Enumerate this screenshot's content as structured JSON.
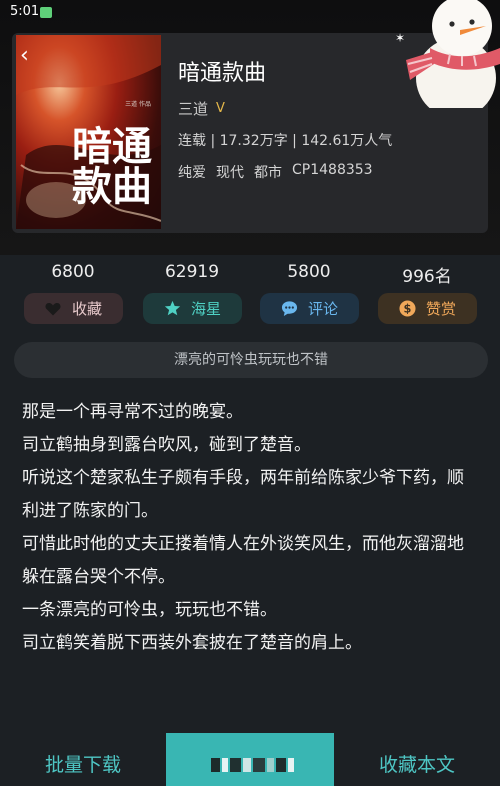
{
  "status_bar": {
    "time": "5:01"
  },
  "book": {
    "title": "暗通款曲",
    "author": "三道",
    "author_badge": "V",
    "stats": "连载 | 17.32万字 | 142.61万人气",
    "tags": [
      "纯爱",
      "现代",
      "都市",
      "CP1488353"
    ],
    "cover": {
      "title": "暗通款曲",
      "author_credit": "三道 作品"
    }
  },
  "counts": {
    "collect": "6800",
    "star": "62919",
    "comment": "5800",
    "reward": "996名"
  },
  "actions": {
    "collect": "收藏",
    "star": "海星",
    "comment": "评论",
    "reward": "赞赏"
  },
  "intro": "漂亮的可怜虫玩玩也不错",
  "excerpt": [
    "那是一个再寻常不过的晚宴。",
    "司立鹤抽身到露台吹风，碰到了楚音。",
    "听说这个楚家私生子颇有手段，两年前给陈家少爷下药，顺利进了陈家的门。",
    "可惜此时他的丈夫正搂着情人在外谈笑风生，而他灰溜溜地躲在露台哭个不停。",
    "一条漂亮的可怜虫，玩玩也不错。",
    "司立鹤笑着脱下西装外套披在了楚音的肩上。"
  ],
  "bottom": {
    "batch_download": "批量下载",
    "read": "",
    "collect_book": "收藏本文"
  },
  "colors": {
    "accent": "#39b6b3",
    "background": "#1c2024"
  }
}
